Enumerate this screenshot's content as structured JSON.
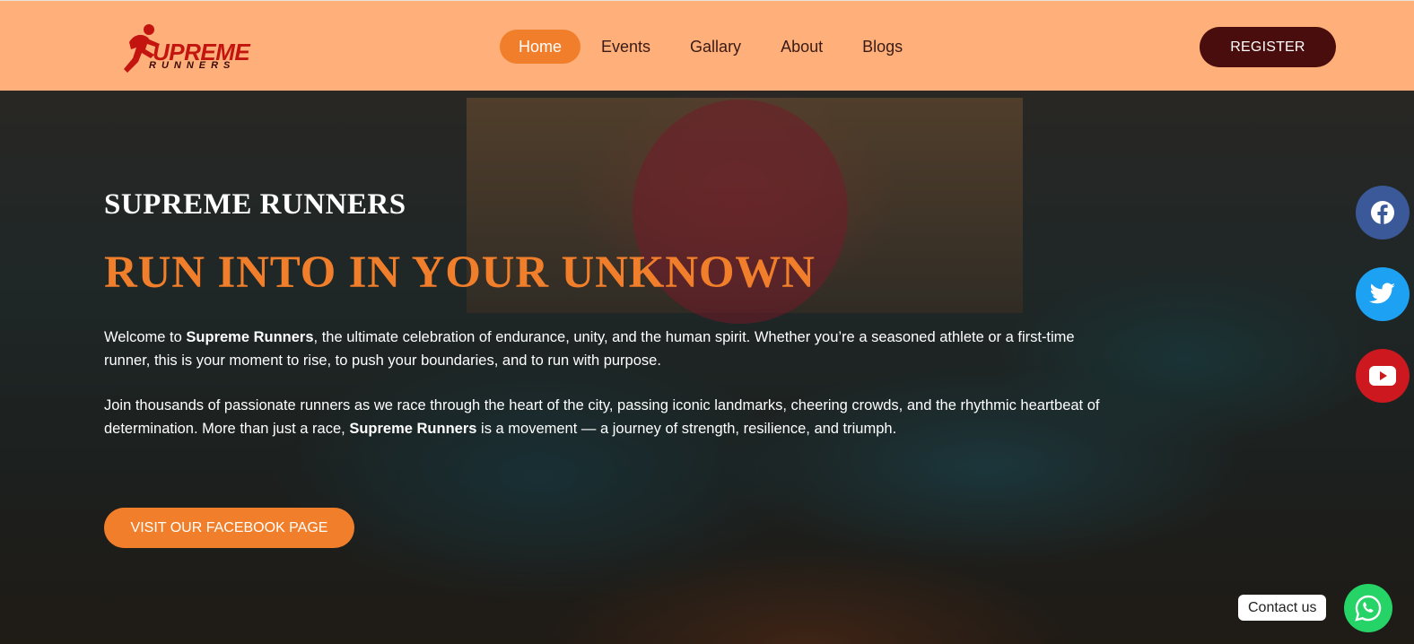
{
  "header": {
    "logo": {
      "main": "UPREME",
      "sub": "RUNNERS",
      "icon": "runner-icon"
    },
    "nav": [
      {
        "label": "Home",
        "active": true
      },
      {
        "label": "Events",
        "active": false
      },
      {
        "label": "Gallary",
        "active": false
      },
      {
        "label": "About",
        "active": false
      },
      {
        "label": "Blogs",
        "active": false
      }
    ],
    "register_label": "REGISTER"
  },
  "hero": {
    "subtitle": "SUPREME RUNNERS",
    "title": "RUN INTO IN YOUR UNKNOWN",
    "p1": {
      "a": "Welcome to ",
      "b": "Supreme Runners",
      "c": ", the ultimate celebration of endurance, unity, and the human spirit. Whether you’re a seasoned athlete or a first-time runner, this is your moment to rise, to push your boundaries, and to run with purpose."
    },
    "p2": {
      "a": "Join thousands of passionate runners as we race through the heart of the city, passing iconic landmarks, cheering crowds, and the rhythmic heartbeat of determination. More than just a race, ",
      "b": "Supreme Runners",
      "c": " is a movement — a journey of strength, resilience, and triumph."
    },
    "cta_label": "VISIT OUR FACEBOOK PAGE"
  },
  "social": [
    {
      "name": "facebook",
      "icon": "facebook-icon",
      "color": "#3b5998"
    },
    {
      "name": "twitter",
      "icon": "twitter-icon",
      "color": "#1da1f2"
    },
    {
      "name": "youtube",
      "icon": "youtube-icon",
      "color": "#cc181e"
    }
  ],
  "contact": {
    "label": "Contact us",
    "icon": "whatsapp-icon",
    "color": "#25d366"
  },
  "colors": {
    "header_bg": "#ffb07a",
    "accent": "#f07e2a",
    "register_bg": "#4a0d0d",
    "logo_red": "#c3140f"
  }
}
